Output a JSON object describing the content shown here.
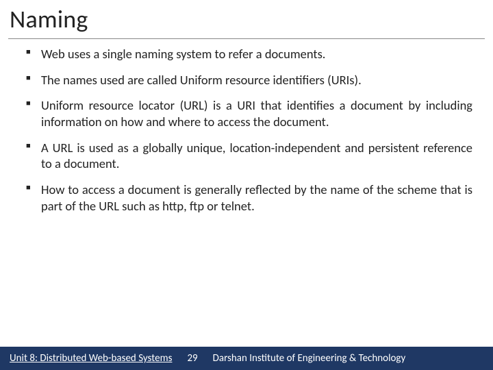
{
  "title": "Naming",
  "bullets": [
    "Web uses a single naming system to refer a documents.",
    "The names used are called Uniform resource identifiers (URIs).",
    "Uniform resource locator (URL) is a URI that identifies a document by including information on how and where to access the document.",
    "A URL is used as a globally unique, location-independent and persistent reference to a document.",
    "How to access a document is generally reflected by the name of the scheme that is part of the URL such as http, ftp or telnet."
  ],
  "footer": {
    "unit": "Unit 8: Distributed Web-based Systems",
    "page": "29",
    "institution": "Darshan Institute of Engineering & Technology"
  }
}
